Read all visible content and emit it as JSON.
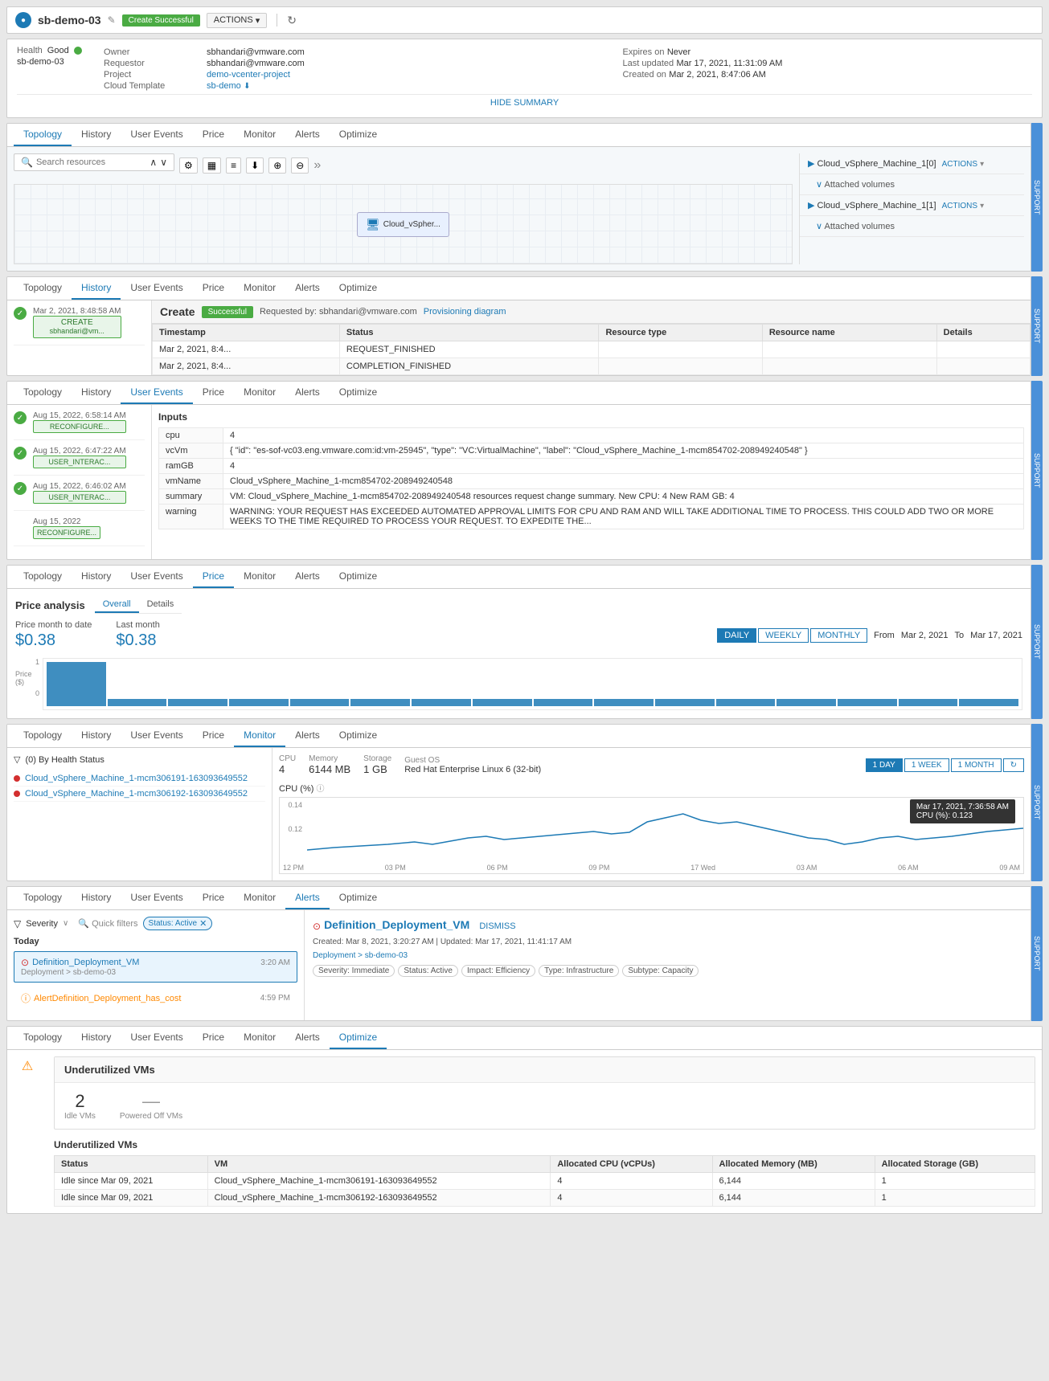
{
  "app": {
    "icon": "SB",
    "title": "sb-demo-03",
    "status": "Create Successful",
    "actions_label": "ACTIONS",
    "edit_tooltip": "Edit"
  },
  "summary": {
    "health_label": "Health",
    "health_status": "Good",
    "instance_name": "sb-demo-03",
    "owner_label": "Owner",
    "owner_value": "sbhandari@vmware.com",
    "requestor_label": "Requestor",
    "requestor_value": "sbhandari@vmware.com",
    "project_label": "Project",
    "project_value": "demo-vcenter-project",
    "cloud_template_label": "Cloud Template",
    "cloud_template_value": "sb-demo",
    "expires_label": "Expires on",
    "expires_value": "Never",
    "last_updated_label": "Last updated",
    "last_updated_value": "Mar 17, 2021, 11:31:09 AM",
    "created_label": "Created on",
    "created_value": "Mar 2, 2021, 8:47:06 AM",
    "hide_summary": "HIDE SUMMARY"
  },
  "tabs": {
    "topology": "Topology",
    "history": "History",
    "user_events": "User Events",
    "price": "Price",
    "monitor": "Monitor",
    "alerts": "Alerts",
    "optimize": "Optimize"
  },
  "topology": {
    "search_placeholder": "Search resources",
    "vm_node": "Cloud_vSpher...",
    "right_panel": {
      "item1": "Cloud_vSphere_Machine_1[0]",
      "item1_actions": "ACTIONS",
      "item1_sub": "Attached volumes",
      "item2": "Cloud_vSphere_Machine_1[1]",
      "item2_actions": "ACTIONS",
      "item2_sub": "Attached volumes"
    }
  },
  "history": {
    "active_tab": "History",
    "date1": "Mar 2, 2021, 8:48:58 AM",
    "action1": "CREATE",
    "action1_user": "sbhandari@vm...",
    "create_title": "Create",
    "create_status": "Successful",
    "requested_by": "Requested by: sbhandari@vmware.com",
    "provision_link": "Provisioning diagram",
    "table_headers": [
      "Timestamp",
      "Status",
      "Resource type",
      "Resource name",
      "Details"
    ],
    "table_rows": [
      [
        "Mar 2, 2021, 8:4...",
        "REQUEST_FINISHED",
        "",
        "",
        ""
      ],
      [
        "Mar 2, 2021, 8:4...",
        "COMPLETION_FINISHED",
        "",
        "",
        ""
      ]
    ]
  },
  "user_events": {
    "active_tab": "User Events",
    "events": [
      {
        "date": "Aug 15, 2022, 6:58:14 AM",
        "action": "RECONFIGURE...",
        "check": true
      },
      {
        "date": "Aug 15, 2022, 6:47:22 AM",
        "action": "USER_INTERAC...",
        "check": true
      },
      {
        "date": "Aug 15, 2022, 6:46:02 AM",
        "action": "USER_INTERAC...",
        "check": true
      },
      {
        "date": "Aug 15, 2022",
        "action": "RECONFIGURE...",
        "check": false
      }
    ],
    "inputs_title": "Inputs",
    "inputs": [
      {
        "key": "cpu",
        "value": "4"
      },
      {
        "key": "vcVm",
        "value": "{ \"id\": \"es-sof-vc03.eng.vmware.com:id:vm-25945\", \"type\": \"VC:VirtualMachine\", \"label\": \"Cloud_vSphere_Machine_1-mcm854702-208949240548\" }"
      },
      {
        "key": "ramGB",
        "value": "4"
      },
      {
        "key": "vmName",
        "value": "Cloud_vSphere_Machine_1-mcm854702-208949240548"
      },
      {
        "key": "summary",
        "value": "VM: Cloud_vSphere_Machine_1-mcm854702-208949240548 resources request change summary. New CPU: 4 New RAM GB: 4"
      },
      {
        "key": "warning",
        "value": "WARNING: YOUR REQUEST HAS EXCEEDED AUTOMATED APPROVAL LIMITS FOR CPU AND RAM AND WILL TAKE ADDITIONAL TIME TO PROCESS. THIS COULD ADD TWO OR MORE WEEKS TO THE TIME REQUIRED TO PROCESS YOUR REQUEST. TO EXPEDITE THE..."
      }
    ]
  },
  "price": {
    "active_tab": "Price",
    "analysis_title": "Price analysis",
    "tab_overall": "Overall",
    "tab_details": "Details",
    "month_to_date_label": "Price month to date",
    "month_to_date_value": "$0.38",
    "last_month_label": "Last month",
    "last_month_value": "$0.38",
    "period_daily": "DAILY",
    "period_weekly": "WEEKLY",
    "period_monthly": "MONTHLY",
    "from_label": "From",
    "from_value": "Mar 2, 2021",
    "to_label": "To",
    "to_value": "Mar 17, 2021",
    "y_axis_label": "Price ($)",
    "y_axis_max": "1",
    "y_axis_zero": "0",
    "bars": [
      0.9,
      0.15,
      0.15,
      0.15,
      0.15,
      0.15,
      0.15,
      0.15,
      0.15,
      0.15,
      0.15,
      0.15,
      0.15,
      0.15,
      0.15,
      0.15
    ]
  },
  "monitor": {
    "active_tab": "Monitor",
    "filter_label": "(0) By Health Status",
    "vms": [
      "Cloud_vSphere_Machine_1-mcm306191-163093649552",
      "Cloud_vSphere_Machine_1-mcm306192-163093649552"
    ],
    "cpu_label": "CPU",
    "cpu_value": "4",
    "memory_label": "Memory",
    "memory_value": "6144 MB",
    "storage_label": "Storage",
    "storage_value": "1 GB",
    "guest_os_label": "Guest OS",
    "guest_os_value": "Red Hat Enterprise Linux 6 (32-bit)",
    "time_1day": "1 DAY",
    "time_1week": "1 WEEK",
    "time_1month": "1 MONTH",
    "cpu_chart_title": "CPU (%)",
    "tooltip_time": "Mar 17, 2021, 7:36:58 AM",
    "tooltip_cpu": "CPU (%): 0.123",
    "tooltip_value": "0.14",
    "cpu_y_max": "0.14",
    "cpu_y_mid": "0.12",
    "time_labels": [
      "12 PM",
      "03 PM",
      "06 PM",
      "09 PM",
      "17 Wed",
      "03 AM",
      "06 AM",
      "09 AM"
    ]
  },
  "alerts": {
    "active_tab": "Alerts",
    "severity_label": "Severity",
    "filter_placeholder": "Quick filters",
    "active_filter": "Status: Active",
    "today_label": "Today",
    "alert_items": [
      {
        "name": "Definition_Deployment_VM",
        "time": "3:20 AM",
        "path": "Deployment > sb-demo-03",
        "type": "error",
        "active": true
      },
      {
        "name": "AlertDefinition_Deployment_has_cost",
        "time": "4:59 PM",
        "path": "",
        "type": "info",
        "active": false
      }
    ],
    "detail": {
      "title": "Definition_Deployment_VM",
      "dismiss": "DISMISS",
      "created": "Created: Mar 8, 2021, 3:20:27 AM",
      "updated": "Updated: Mar 17, 2021, 11:41:17 AM",
      "path": "Deployment > sb-demo-03",
      "tags": [
        "Severity: Immediate",
        "Status: Active",
        "Impact: Efficiency",
        "Type: Infrastructure",
        "Subtype: Capacity"
      ]
    }
  },
  "optimize": {
    "active_tab": "Optimize",
    "warning_icon": "⚠",
    "section_title": "Underutilized VMs",
    "idle_vms_count": "2",
    "idle_vms_label": "Idle VMs",
    "powered_off_label": "Powered Off VMs",
    "powered_off_value": "—",
    "table_title": "Underutilized VMs",
    "table_headers": [
      "Status",
      "VM",
      "Allocated CPU (vCPUs)",
      "Allocated Memory (MB)",
      "Allocated Storage (GB)"
    ],
    "table_rows": [
      [
        "Idle since Mar 09, 2021",
        "Cloud_vSphere_Machine_1-mcm306191-163093649552",
        "4",
        "6,144",
        "1"
      ],
      [
        "Idle since Mar 09, 2021",
        "Cloud_vSphere_Machine_1-mcm306192-163093649552",
        "4",
        "6,144",
        "1"
      ]
    ]
  },
  "side_grips": {
    "label1": "SUPPORT",
    "label2": "SUPPORT",
    "label3": "SUPPORT",
    "label4": "SUPPORT",
    "label5": "SUPPORT",
    "label6": "SUPPORT"
  }
}
